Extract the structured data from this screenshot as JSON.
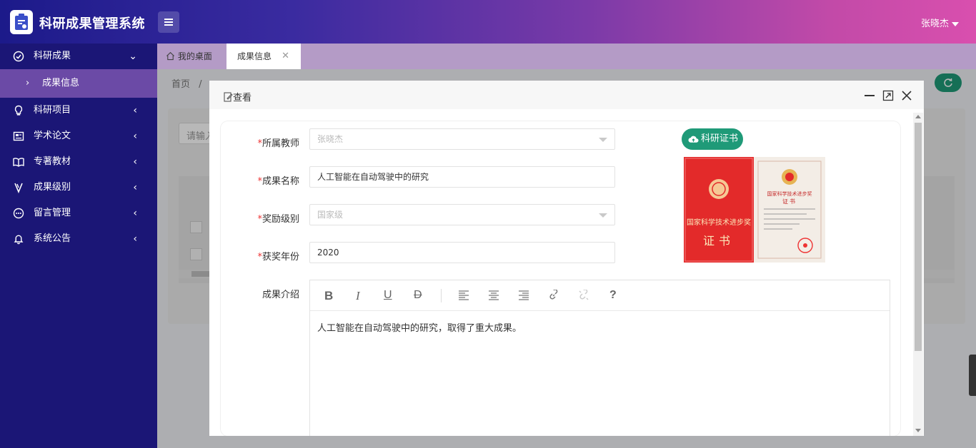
{
  "app": {
    "title": "科研成果管理系统",
    "user": "张晓杰"
  },
  "sidebar": {
    "items": [
      {
        "label": "科研成果",
        "icon": "check-circle-icon",
        "expanded": true
      },
      {
        "label": "成果信息",
        "icon": "chevron-right-icon",
        "sub": true
      },
      {
        "label": "科研项目",
        "icon": "lightbulb-icon"
      },
      {
        "label": "学术论文",
        "icon": "document-icon"
      },
      {
        "label": "专著教材",
        "icon": "book-icon"
      },
      {
        "label": "成果级别",
        "icon": "medal-icon"
      },
      {
        "label": "留言管理",
        "icon": "chat-icon"
      },
      {
        "label": "系统公告",
        "icon": "bell-icon"
      }
    ]
  },
  "tabs": [
    {
      "label": "我的桌面",
      "icon": "home-icon"
    },
    {
      "label": "成果信息",
      "active": true
    }
  ],
  "breadcrumb": {
    "home": "首页",
    "sep": "/"
  },
  "search": {
    "placeholder": "请输入"
  },
  "dialog": {
    "title": "查看",
    "fields": {
      "teacher": {
        "label": "所属教师",
        "value": "张晓杰"
      },
      "name": {
        "label": "成果名称",
        "value": "人工智能在自动驾驶中的研究"
      },
      "level": {
        "label": "奖励级别",
        "value": "国家级"
      },
      "year": {
        "label": "获奖年份",
        "value": "2020"
      },
      "intro": {
        "label": "成果介绍",
        "value": "人工智能在自动驾驶中的研究，取得了重大成果。"
      }
    },
    "cert_button": "科研证书",
    "cert_image": {
      "left_line1": "国家科学技术进步奖",
      "left_line2": "证书",
      "right_line1": "国家科学技术进步奖",
      "right_line2": "证书"
    },
    "editor_toolbar": [
      "bold-icon",
      "italic-icon",
      "underline-icon",
      "strikethrough-icon",
      "align-left-icon",
      "align-center-icon",
      "align-right-icon",
      "link-icon",
      "unlink-icon",
      "help-icon"
    ],
    "help_glyph": "?"
  },
  "colors": {
    "sidebar": "#1b1676",
    "accent": "#1f9a78",
    "sub_active": "#6b4aa6",
    "tabs_bar": "#b49bc6",
    "required": "#ee3333"
  }
}
